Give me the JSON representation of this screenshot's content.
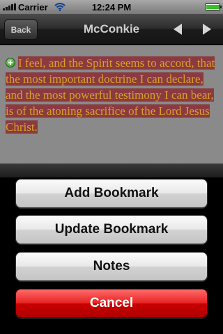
{
  "status_bar": {
    "carrier": "Carrier",
    "time": "12:24 PM",
    "battery_level": 0.95,
    "battery_color": "#3bbf2e"
  },
  "nav": {
    "back_label": "Back",
    "title": "McConkie",
    "prev_icon": "triangle-left-icon",
    "next_icon": "triangle-right-icon"
  },
  "content": {
    "icon": "plus-circle-icon",
    "quote": "I feel, and the Spirit seems to accord, that the most important doctrine I can declare, and the most powerful testimony I can bear, is of the atoning sacrifice of the Lord Jesus Christ.",
    "highlight_bg": "#8b3b40",
    "highlight_text": "#d9a02a"
  },
  "action_sheet": {
    "add_bookmark": "Add Bookmark",
    "update_bookmark": "Update Bookmark",
    "notes": "Notes",
    "cancel": "Cancel",
    "cancel_color": "#e82424"
  }
}
